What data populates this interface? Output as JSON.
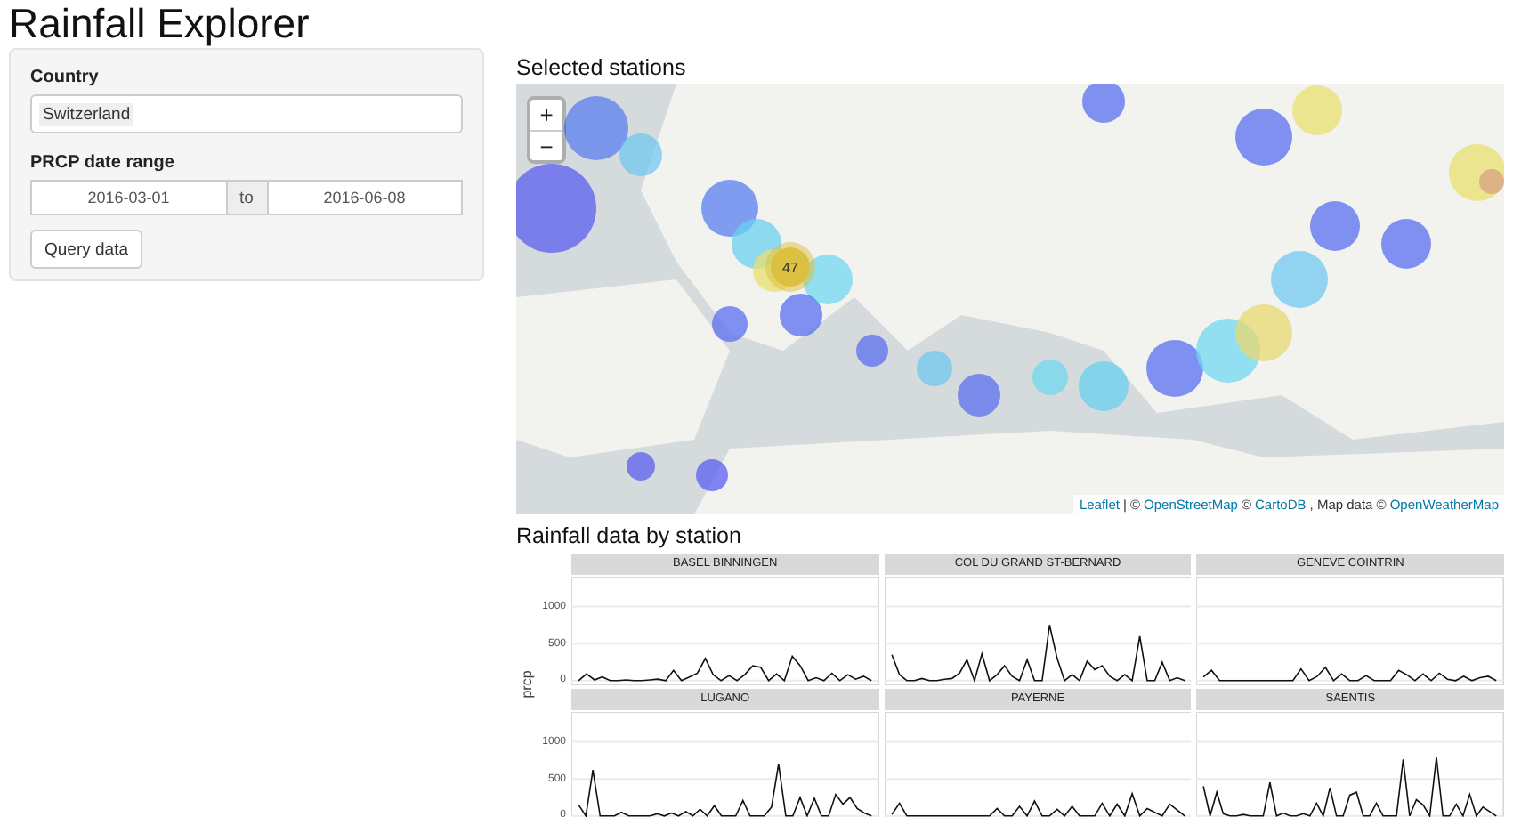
{
  "title": "Rainfall Explorer",
  "sidebar": {
    "country": {
      "label": "Country",
      "value": "Switzerland"
    },
    "date_range": {
      "label": "PRCP date range",
      "start": "2016-03-01",
      "separator": "to",
      "end": "2016-06-08"
    },
    "button": "Query data"
  },
  "map_section": {
    "title": "Selected stations",
    "zoom_in": "+",
    "zoom_out": "−",
    "cluster_count": "47",
    "attribution": [
      {
        "kind": "link",
        "text": "Leaflet"
      },
      {
        "kind": "plain",
        "text": "| ©"
      },
      {
        "kind": "link",
        "text": "OpenStreetMap"
      },
      {
        "kind": "plain",
        "text": "©"
      },
      {
        "kind": "link",
        "text": "CartoDB"
      },
      {
        "kind": "plain",
        "text": ", Map data ©"
      },
      {
        "kind": "link",
        "text": "OpenWeatherMap"
      }
    ]
  },
  "plots": {
    "title": "Rainfall data by station",
    "ylabel": "prcp",
    "panels": [
      {
        "kind": "chart",
        "chart_data": {
          "type": "line",
          "title": "BASEL BINNINGEN",
          "grid": true,
          "ylim": [
            -60,
            1400
          ],
          "yticks": [
            0,
            500,
            1000
          ],
          "values": [
            0,
            90,
            10,
            50,
            0,
            0,
            10,
            0,
            0,
            10,
            20,
            0,
            140,
            0,
            50,
            100,
            300,
            80,
            0,
            70,
            0,
            80,
            200,
            180,
            0,
            90,
            0,
            330,
            200,
            0,
            40,
            0,
            100,
            0,
            80,
            20,
            60,
            0
          ]
        }
      },
      {
        "kind": "picture",
        "title": "COL DU GRAND ST-BERNARD"
      },
      {
        "kind": "picture",
        "title": "GENEVE COINTRIN"
      },
      {
        "kind": "chart",
        "chart_data": {
          "type": "line",
          "title": "LUGANO",
          "grid": true,
          "ylim": [
            -60,
            1400
          ],
          "yticks": [
            0,
            500,
            1000
          ],
          "values": [
            150,
            0,
            620,
            0,
            0,
            0,
            50,
            0,
            0,
            0,
            0,
            30,
            0,
            40,
            0,
            60,
            0,
            90,
            0,
            140,
            0,
            0,
            0,
            210,
            0,
            0,
            0,
            120,
            700,
            0,
            0,
            250,
            0,
            240,
            0,
            0,
            290,
            160,
            250,
            100,
            40,
            0
          ]
        }
      },
      {
        "kind": "picture",
        "title": "PAYERNE"
      },
      {
        "kind": "picture",
        "title": "SAENTIS"
      }
    ]
  }
}
